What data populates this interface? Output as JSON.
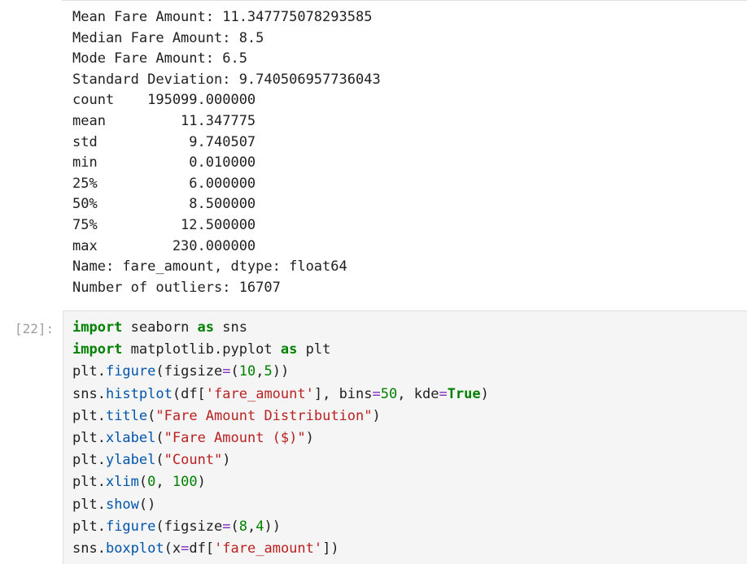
{
  "output": {
    "lines": [
      "Mean Fare Amount: 11.347775078293585",
      "Median Fare Amount: 8.5",
      "Mode Fare Amount: 6.5",
      "Standard Deviation: 9.740506957736043",
      "count    195099.000000",
      "mean         11.347775",
      "std           9.740507",
      "min           0.010000",
      "25%           6.000000",
      "50%           8.500000",
      "75%          12.500000",
      "max         230.000000",
      "Name: fare_amount, dtype: float64",
      "Number of outliers: 16707"
    ]
  },
  "cell": {
    "prompt": "[22]:",
    "lines": [
      [
        {
          "t": "import",
          "c": "kw"
        },
        {
          "t": " seaborn ",
          "c": "plain"
        },
        {
          "t": "as",
          "c": "kw"
        },
        {
          "t": " sns",
          "c": "plain"
        }
      ],
      [
        {
          "t": "import",
          "c": "kw"
        },
        {
          "t": " matplotlib.pyplot ",
          "c": "plain"
        },
        {
          "t": "as",
          "c": "kw"
        },
        {
          "t": " plt",
          "c": "plain"
        }
      ],
      [
        {
          "t": "plt.",
          "c": "plain"
        },
        {
          "t": "figure",
          "c": "fn"
        },
        {
          "t": "(figsize",
          "c": "plain"
        },
        {
          "t": "=",
          "c": "op"
        },
        {
          "t": "(",
          "c": "plain"
        },
        {
          "t": "10",
          "c": "num"
        },
        {
          "t": ",",
          "c": "plain"
        },
        {
          "t": "5",
          "c": "num"
        },
        {
          "t": "))",
          "c": "plain"
        }
      ],
      [
        {
          "t": "sns.",
          "c": "plain"
        },
        {
          "t": "histplot",
          "c": "fn"
        },
        {
          "t": "(df[",
          "c": "plain"
        },
        {
          "t": "'fare_amount'",
          "c": "str"
        },
        {
          "t": "], bins",
          "c": "plain"
        },
        {
          "t": "=",
          "c": "op"
        },
        {
          "t": "50",
          "c": "num"
        },
        {
          "t": ", kde",
          "c": "plain"
        },
        {
          "t": "=",
          "c": "op"
        },
        {
          "t": "True",
          "c": "kw"
        },
        {
          "t": ")",
          "c": "plain"
        }
      ],
      [
        {
          "t": "plt.",
          "c": "plain"
        },
        {
          "t": "title",
          "c": "fn"
        },
        {
          "t": "(",
          "c": "plain"
        },
        {
          "t": "\"Fare Amount Distribution\"",
          "c": "str"
        },
        {
          "t": ")",
          "c": "plain"
        }
      ],
      [
        {
          "t": "plt.",
          "c": "plain"
        },
        {
          "t": "xlabel",
          "c": "fn"
        },
        {
          "t": "(",
          "c": "plain"
        },
        {
          "t": "\"Fare Amount ($)\"",
          "c": "str"
        },
        {
          "t": ")",
          "c": "plain"
        }
      ],
      [
        {
          "t": "plt.",
          "c": "plain"
        },
        {
          "t": "ylabel",
          "c": "fn"
        },
        {
          "t": "(",
          "c": "plain"
        },
        {
          "t": "\"Count\"",
          "c": "str"
        },
        {
          "t": ")",
          "c": "plain"
        }
      ],
      [
        {
          "t": "plt.",
          "c": "plain"
        },
        {
          "t": "xlim",
          "c": "fn"
        },
        {
          "t": "(",
          "c": "plain"
        },
        {
          "t": "0",
          "c": "num"
        },
        {
          "t": ", ",
          "c": "plain"
        },
        {
          "t": "100",
          "c": "num"
        },
        {
          "t": ")",
          "c": "plain"
        }
      ],
      [
        {
          "t": "plt.",
          "c": "plain"
        },
        {
          "t": "show",
          "c": "fn"
        },
        {
          "t": "()",
          "c": "plain"
        }
      ],
      [
        {
          "t": "plt.",
          "c": "plain"
        },
        {
          "t": "figure",
          "c": "fn"
        },
        {
          "t": "(figsize",
          "c": "plain"
        },
        {
          "t": "=",
          "c": "op"
        },
        {
          "t": "(",
          "c": "plain"
        },
        {
          "t": "8",
          "c": "num"
        },
        {
          "t": ",",
          "c": "plain"
        },
        {
          "t": "4",
          "c": "num"
        },
        {
          "t": "))",
          "c": "plain"
        }
      ],
      [
        {
          "t": "sns.",
          "c": "plain"
        },
        {
          "t": "boxplot",
          "c": "fn"
        },
        {
          "t": "(x",
          "c": "plain"
        },
        {
          "t": "=",
          "c": "op"
        },
        {
          "t": "df[",
          "c": "plain"
        },
        {
          "t": "'fare_amount'",
          "c": "str"
        },
        {
          "t": "])",
          "c": "plain"
        }
      ]
    ]
  }
}
